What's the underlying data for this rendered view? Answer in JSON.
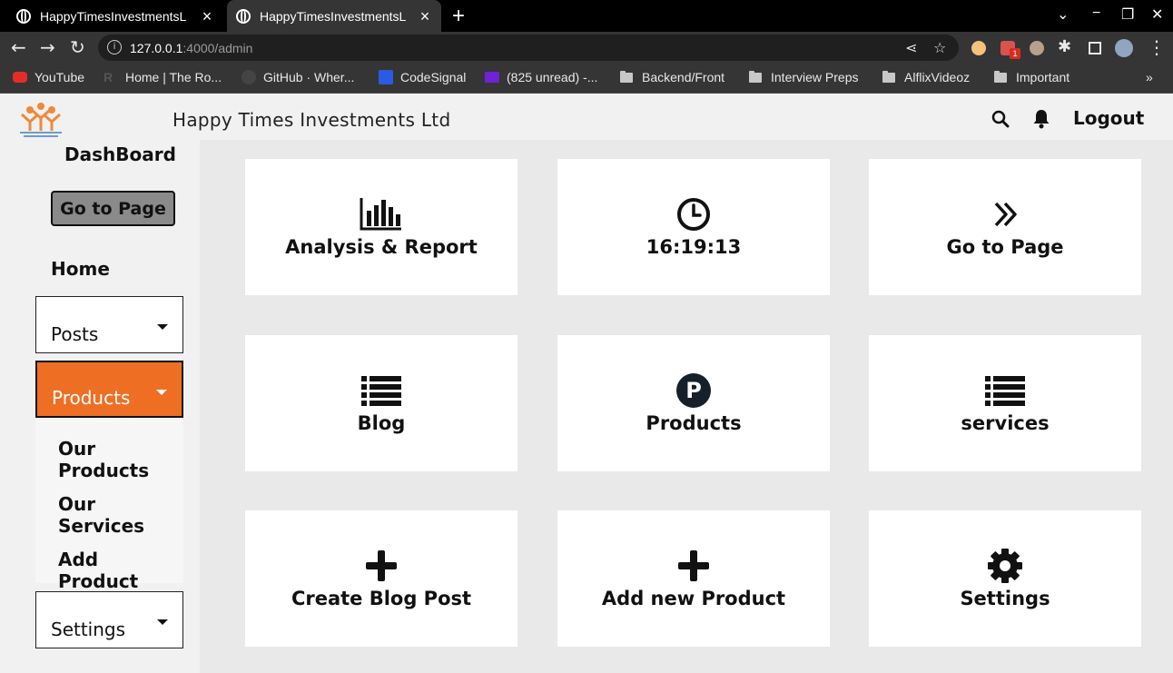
{
  "browser": {
    "tabs": [
      {
        "title": "HappyTimesInvestmentsL",
        "active": false
      },
      {
        "title": "HappyTimesInvestmentsL",
        "active": true
      }
    ],
    "url_host": "127.0.0.1",
    "url_rest": ":4000/admin",
    "bookmarks": [
      {
        "label": "YouTube",
        "icon": "youtube-icon"
      },
      {
        "label": "Home | The Ro...",
        "icon": "r-icon"
      },
      {
        "label": "GitHub · Wher...",
        "icon": "github-icon"
      },
      {
        "label": "CodeSignal",
        "icon": "codesignal-icon"
      },
      {
        "label": "(825 unread) -...",
        "icon": "mail-icon"
      },
      {
        "label": "Backend/Front",
        "icon": "folder-icon"
      },
      {
        "label": "Interview Preps",
        "icon": "folder-icon"
      },
      {
        "label": "AlflixVideoz",
        "icon": "folder-icon"
      },
      {
        "label": "Important",
        "icon": "folder-icon"
      }
    ],
    "extension_badge": "1"
  },
  "header": {
    "site_title": "Happy Times Investments Ltd",
    "logout_label": "Logout"
  },
  "sidebar": {
    "dashboard_label": "DashBoard",
    "goto_label": "Go to Page",
    "home_label": "Home",
    "posts_label": "Posts",
    "products_label": "Products",
    "products_submenu": [
      "Our Products",
      "Our Services",
      "Add Product"
    ],
    "settings_label": "Settings"
  },
  "cards": [
    {
      "label": "Analysis & Report",
      "icon": "bar-chart-icon"
    },
    {
      "label": "16:19:13",
      "icon": "clock-icon"
    },
    {
      "label": "Go to Page",
      "icon": "double-chevron-right-icon"
    },
    {
      "label": "Blog",
      "icon": "list-icon"
    },
    {
      "label": "Products",
      "icon": "product-p-icon"
    },
    {
      "label": "services",
      "icon": "list-icon"
    },
    {
      "label": "Create Blog Post",
      "icon": "plus-icon"
    },
    {
      "label": "Add new Product",
      "icon": "plus-icon"
    },
    {
      "label": "Settings",
      "icon": "gear-icon"
    }
  ],
  "colors": {
    "accent": "#ee6f24",
    "dark": "#111111"
  }
}
